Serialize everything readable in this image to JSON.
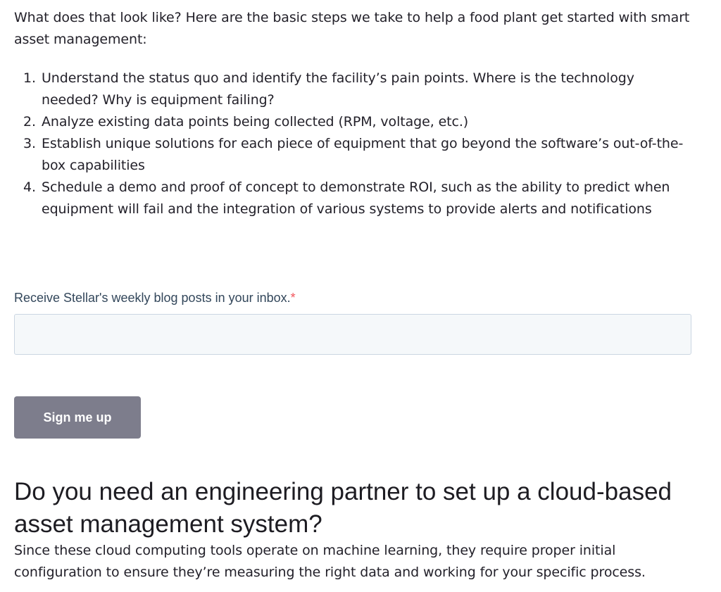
{
  "intro": "What does that look like? Here are the basic steps we take to help a food plant get started with smart asset management:",
  "steps": [
    {
      "num": "1.",
      "text": "Understand the status quo and identify the facility’s pain points. Where is the technology needed? Why is equipment failing?"
    },
    {
      "num": "2.",
      "text": "Analyze existing data points being collected (RPM, voltage, etc.)"
    },
    {
      "num": "3.",
      "text": "Establish unique solutions for each piece of equipment that go beyond the software’s out-of-the-box capabilities"
    },
    {
      "num": "4.",
      "text": "Schedule a demo and proof of concept to demonstrate ROI, such as the ability to predict when equipment will fail and the integration of various systems to provide alerts and notifications"
    }
  ],
  "form": {
    "label": "Receive Stellar's weekly blog posts in your inbox.",
    "required_mark": "*",
    "email_value": "",
    "submit_label": "Sign me up"
  },
  "section": {
    "heading": "Do you need an engineering partner to set up a cloud-based asset management system?",
    "body": "Since these cloud computing tools operate on machine learning, they require proper initial configuration to ensure they’re measuring the right data and working for your specific process."
  },
  "colors": {
    "text": "#23212a",
    "label": "#33475b",
    "required": "#f2545b",
    "input_bg": "#f5f8fa",
    "input_border": "#cbd6e2",
    "button_bg": "#7d7d8c",
    "button_text": "#ffffff"
  }
}
